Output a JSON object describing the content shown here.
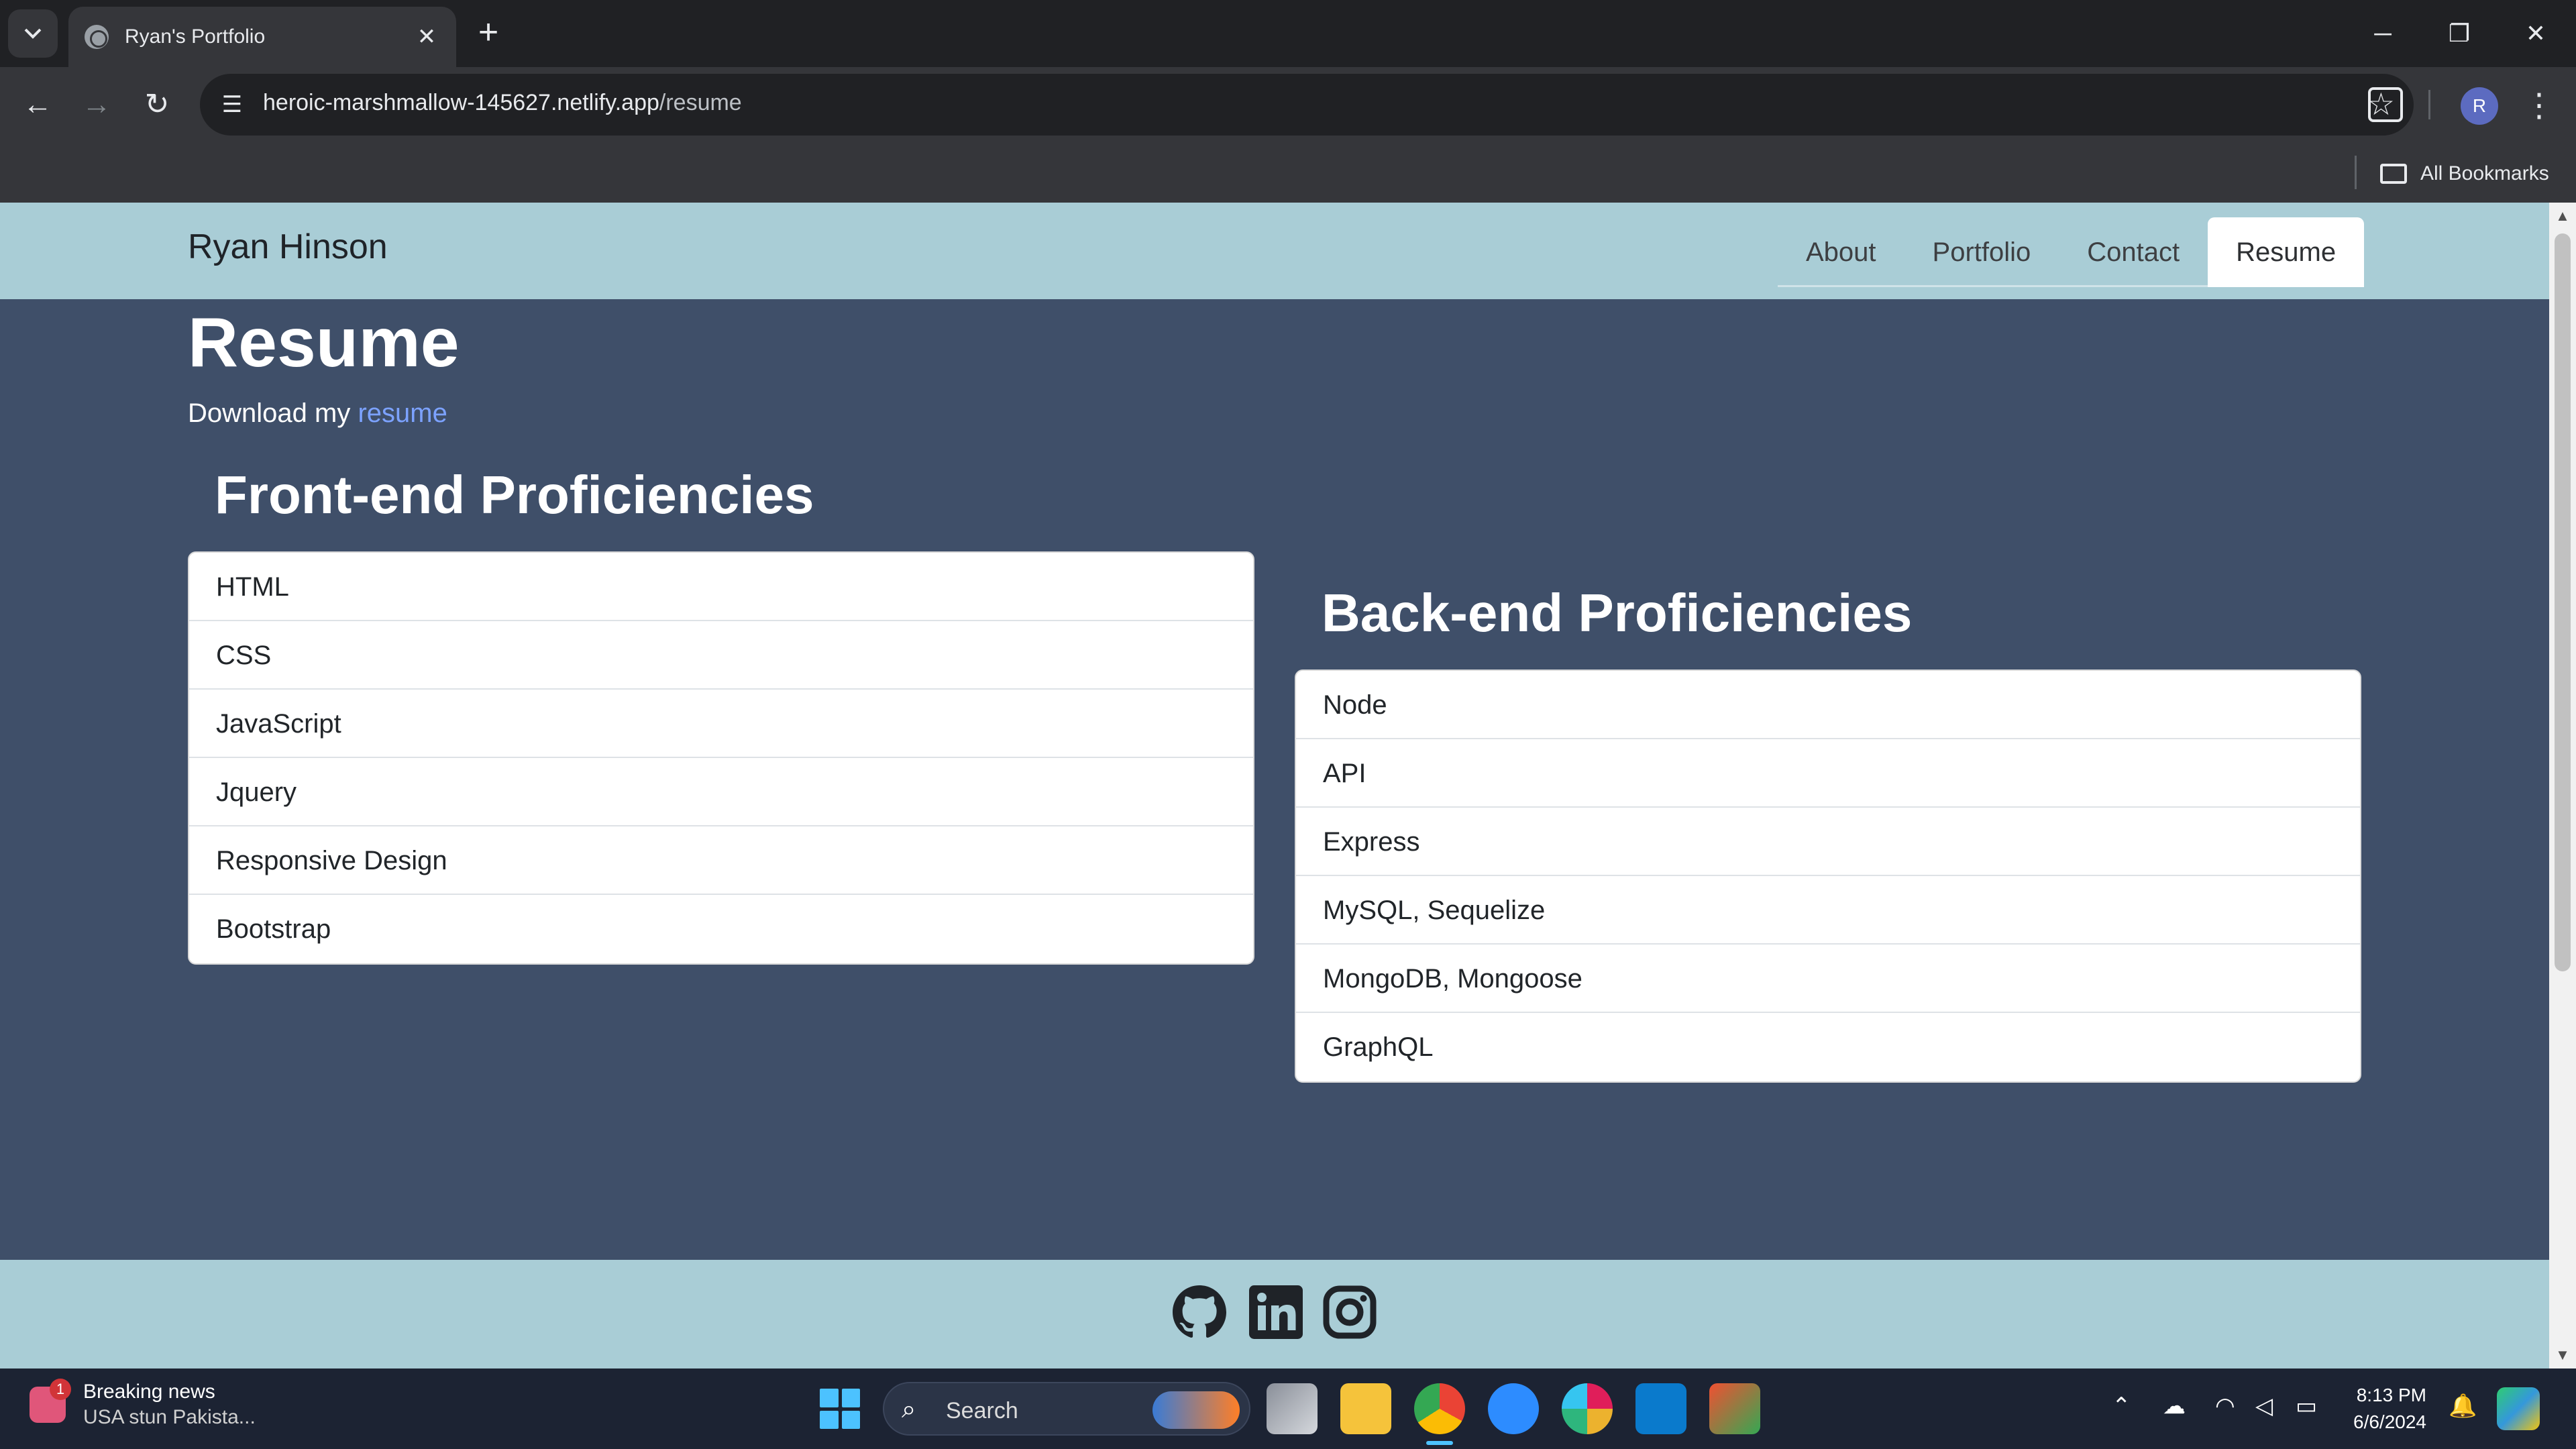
{
  "browser": {
    "tab_title": "Ryan's Portfolio",
    "url_host": "heroic-marshmallow-145627.netlify.app",
    "url_path": "/resume",
    "bookmarks_label": "All Bookmarks",
    "profile_initial": "R"
  },
  "site": {
    "brand": "Ryan Hinson",
    "nav": [
      "About",
      "Portfolio",
      "Contact",
      "Resume"
    ],
    "active_nav": "Resume",
    "page_title": "Resume",
    "download_prefix": "Download my ",
    "download_link": "resume",
    "frontend": {
      "heading": "Front-end Proficiencies",
      "items": [
        "HTML",
        "CSS",
        "JavaScript",
        "Jquery",
        "Responsive Design",
        "Bootstrap"
      ]
    },
    "backend": {
      "heading": "Back-end Proficiencies",
      "items": [
        "Node",
        "API",
        "Express",
        "MySQL, Sequelize",
        "MongoDB, Mongoose",
        "GraphQL"
      ]
    },
    "footer_icons": [
      "github-icon",
      "linkedin-icon",
      "instagram-icon"
    ]
  },
  "taskbar": {
    "news_count": "1",
    "news_title": "Breaking news",
    "news_subtitle": "USA stun Pakista...",
    "search_label": "Search",
    "time": "8:13 PM",
    "date": "6/6/2024"
  }
}
